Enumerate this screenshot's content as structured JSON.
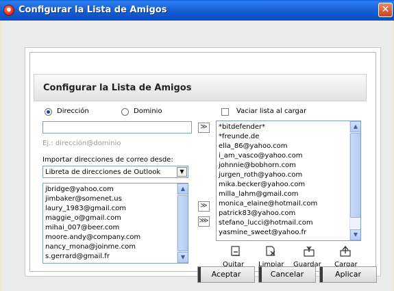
{
  "window": {
    "title": "Configurar la Lista de Amigos",
    "close_glyph": "✕"
  },
  "panel": {
    "heading": "Configurar la Lista de Amigos"
  },
  "mode": {
    "direccion_label": "Dirección",
    "dominio_label": "Dominio",
    "selected": "Dirección"
  },
  "vaciar": {
    "label": "Vaciar lista al cargar",
    "checked": false
  },
  "address_input": {
    "value": "",
    "hint": "Ej.: dirección@dominio"
  },
  "import": {
    "label": "Importar direcciones de correo desde:",
    "selected": "Libreta de direcciones de Outlook"
  },
  "source_list": [
    "jbridge@yahoo.com",
    "jimbaker@somenet.us",
    "laury_1983@gmail.com",
    "maggie_o@gmail.com",
    "mihai_007@beer.com",
    "moore.andy@company.com",
    "nancy_mona@joinme.com",
    "s.gerrard@gmail.fr"
  ],
  "friends_list": [
    "*bitdefender*",
    "*freunde.de",
    "ella_86@yahoo.com",
    "i_am_vasco@yahoo.com",
    "johnnie@bobhorn.com",
    "jurgen_roth@yahoo.com",
    "mika.becker@yahoo.com",
    "milla_lahm@gmail.com",
    "monica_elaine@hotmail.com",
    "patrick83@yahoo.com",
    "stefano_lucci@hotmail.com",
    "yasmine_sweet@yahoo.fr"
  ],
  "tools": {
    "quitar": "Quitar",
    "limpiar": "Limpiar",
    "guardar": "Guardar",
    "cargar": "Cargar"
  },
  "buttons": {
    "aceptar": "Aceptar",
    "cancelar": "Cancelar",
    "aplicar": "Aplicar"
  },
  "glyphs": {
    "arrow_single": "≫",
    "arrow_double": "⋙",
    "scroll_up": "▲",
    "scroll_down": "▼",
    "dropdown": "▼"
  },
  "colors": {
    "titlebar": "#0a4cc4",
    "accent": "#1a3fb0",
    "scrollbar": "#b4cbf2"
  }
}
